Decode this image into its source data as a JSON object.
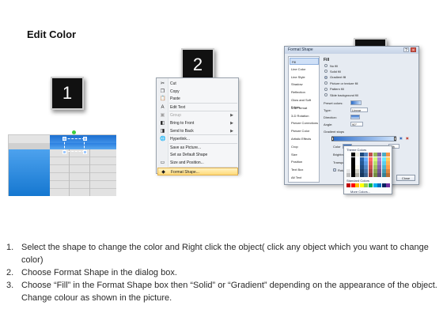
{
  "page": {
    "title": "Edit Color"
  },
  "steps": [
    "1",
    "2",
    "3"
  ],
  "context_menu": {
    "items": [
      {
        "label": "Cut",
        "icon": "scissors-icon",
        "glyph": "✂",
        "disabled": false,
        "submenu": false
      },
      {
        "label": "Copy",
        "icon": "copy-icon",
        "glyph": "❐",
        "disabled": false,
        "submenu": false
      },
      {
        "label": "Paste",
        "icon": "paste-icon",
        "glyph": "📋",
        "disabled": false,
        "submenu": false
      },
      {
        "label": "Edit Text",
        "icon": "edit-text-icon",
        "glyph": "A",
        "disabled": false,
        "submenu": false
      },
      {
        "label": "Group",
        "icon": "group-icon",
        "glyph": "▣",
        "disabled": true,
        "submenu": true
      },
      {
        "label": "Bring to Front",
        "icon": "bring-front-icon",
        "glyph": "◧",
        "disabled": false,
        "submenu": true
      },
      {
        "label": "Send to Back",
        "icon": "send-back-icon",
        "glyph": "◨",
        "disabled": false,
        "submenu": true
      },
      {
        "label": "Hyperlink...",
        "icon": "hyperlink-icon",
        "glyph": "🌐",
        "disabled": false,
        "submenu": false
      },
      {
        "label": "Save as Picture...",
        "icon": "",
        "glyph": "",
        "disabled": false,
        "submenu": false
      },
      {
        "label": "Set as Default Shape",
        "icon": "",
        "glyph": "",
        "disabled": false,
        "submenu": false
      },
      {
        "label": "Size and Position...",
        "icon": "size-position-icon",
        "glyph": "▭",
        "disabled": false,
        "submenu": false
      },
      {
        "label": "Format Shape...",
        "icon": "format-shape-icon",
        "glyph": "◆",
        "disabled": false,
        "submenu": false,
        "active": true
      }
    ]
  },
  "dialog": {
    "title": "Format Shape",
    "categories": [
      "Fill",
      "Line Color",
      "Line Style",
      "Shadow",
      "Reflection",
      "Glow and Soft Edges",
      "3-D Format",
      "3-D Rotation",
      "Picture Corrections",
      "Picture Color",
      "Artistic Effects",
      "Crop",
      "Size",
      "Position",
      "Text Box",
      "Alt Text"
    ],
    "selected_category": "Fill",
    "pane_title": "Fill",
    "options": [
      "No fill",
      "Solid fill",
      "Gradient fill",
      "Picture or texture fill",
      "Pattern fill",
      "Slide background fill"
    ],
    "selected_option": "Gradient fill",
    "fields": {
      "preset_label": "Preset colors:",
      "type_label": "Type:",
      "type_value": "Linear",
      "direction_label": "Direction:",
      "angle_label": "Angle:",
      "angle_value": "90°",
      "stops_label": "Gradient stops",
      "color_label": "Color",
      "position_label": "Position:",
      "position_value": "0%",
      "brightness_label": "Brightness:",
      "transparency_label": "Transparency:",
      "rotate_label": "Rotate w"
    },
    "close_label": "Close"
  },
  "palette": {
    "theme_label": "Theme Colors",
    "standard_label": "Standard Colors",
    "more_label": "More Colors...",
    "theme_top": [
      "#ffffff",
      "#000000",
      "#eeece1",
      "#1f497d",
      "#4f81bd",
      "#c0504d",
      "#9bbb59",
      "#8064a2",
      "#4bacc6",
      "#f79646"
    ],
    "standard": [
      "#c00000",
      "#ff0000",
      "#ffc000",
      "#ffff00",
      "#92d050",
      "#00b050",
      "#00b0f0",
      "#0070c0",
      "#002060",
      "#7030a0"
    ]
  },
  "instructions": [
    "Select the shape to change the color and Right click the object( click any object which you want to change color)",
    "Choose Format Shape in the dialog box.",
    "Choose “Fill” in the Format Shape box then “Solid” or “Gradient” depending on the appearance of the object. Change colour as shown in the picture."
  ],
  "colors": {
    "accent_blue": "#1f7fd8",
    "badge_bg": "#111111",
    "menu_highlight": "#ffd978"
  }
}
